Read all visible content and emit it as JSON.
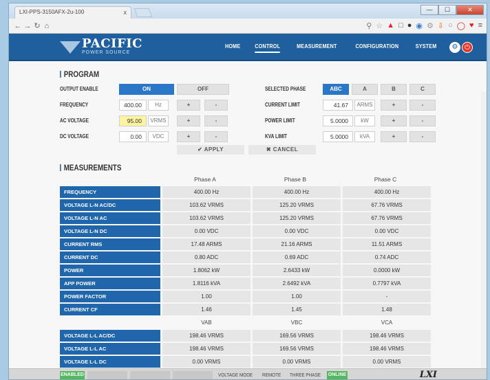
{
  "browser": {
    "tab_title": "LXI-PPS-3150AFX-2u-100",
    "tab_close": "x",
    "url": "",
    "window_buttons": [
      "—",
      "☐",
      "✕"
    ]
  },
  "header": {
    "logo_name": "PACIFIC",
    "logo_sub": "POWER SOURCE",
    "nav": [
      "HOME",
      "CONTROL",
      "MEASUREMENT",
      "CONFIGURATION",
      "SYSTEM"
    ],
    "active_nav": "CONTROL"
  },
  "program": {
    "title": "PROGRAM",
    "output_enable": {
      "label": "OUTPUT ENABLE",
      "on": "ON",
      "off": "OFF"
    },
    "frequency": {
      "label": "FREQUENCY",
      "value": "400.00",
      "unit": "Hz"
    },
    "ac_voltage": {
      "label": "AC VOLTAGE",
      "value": "95.00",
      "unit": "VRMS"
    },
    "dc_voltage": {
      "label": "DC VOLTAGE",
      "value": "0.00",
      "unit": "VDC"
    },
    "selected_phase": {
      "label": "SELECTED PHASE",
      "options": [
        "ABC",
        "A",
        "B",
        "C"
      ]
    },
    "current_limit": {
      "label": "CURRENT LIMIT",
      "value": "41.67",
      "unit": "ARMS"
    },
    "power_limit": {
      "label": "POWER LIMIT",
      "value": "5.0000",
      "unit": "kW"
    },
    "kva_limit": {
      "label": "KVA LIMIT",
      "value": "5.0000",
      "unit": "kVA"
    },
    "plus": "+",
    "minus": "-",
    "apply": "✔ APPLY",
    "cancel": "✖ CANCEL"
  },
  "measurements": {
    "title": "MEASUREMENTS",
    "phase_headers": [
      "Phase A",
      "Phase B",
      "Phase C"
    ],
    "rows": [
      {
        "label": "FREQUENCY",
        "values": [
          "400.00 Hz",
          "400.00 Hz",
          "400.00 Hz"
        ]
      },
      {
        "label": "VOLTAGE L-N AC/DC",
        "values": [
          "103.62 VRMS",
          "125.20 VRMS",
          "67.76 VRMS"
        ]
      },
      {
        "label": "VOLTAGE L-N AC",
        "values": [
          "103.62 VRMS",
          "125.20 VRMS",
          "67.76 VRMS"
        ]
      },
      {
        "label": "VOLTAGE L-N DC",
        "values": [
          "0.00 VDC",
          "0.00 VDC",
          "0.00 VDC"
        ]
      },
      {
        "label": "CURRENT RMS",
        "values": [
          "17.48 ARMS",
          "21.16 ARMS",
          "11.51 ARMS"
        ]
      },
      {
        "label": "CURRENT DC",
        "values": [
          "0.80 ADC",
          "0.69 ADC",
          "0.74 ADC"
        ]
      },
      {
        "label": "POWER",
        "values": [
          "1.8062 kW",
          "2.6433 kW",
          "0.0000 kW"
        ]
      },
      {
        "label": "APP POWER",
        "values": [
          "1.8116 kVA",
          "2.6492 kVA",
          "0.7797 kVA"
        ]
      },
      {
        "label": "POWER FACTOR",
        "values": [
          "1.00",
          "1.00",
          "-"
        ]
      },
      {
        "label": "CURRENT CF",
        "values": [
          "1.46",
          "1.45",
          "1.48"
        ]
      }
    ],
    "ll_headers": [
      "VAB",
      "VBC",
      "VCA"
    ],
    "ll_rows": [
      {
        "label": "VOLTAGE L-L AC/DC",
        "values": [
          "198.46 VRMS",
          "169.56 VRMS",
          "198.46 VRMS"
        ]
      },
      {
        "label": "VOLTAGE L-L AC",
        "values": [
          "198.46 VRMS",
          "169.56 VRMS",
          "198.46 VRMS"
        ]
      },
      {
        "label": "VOLTAGE L-L DC",
        "values": [
          "0.00 VRMS",
          "0.00 VRMS",
          "0.00 VRMS"
        ]
      }
    ]
  },
  "status": {
    "enabled": "ENABLED",
    "mode": "VOLTAGE MODE",
    "remote": "REMOTE",
    "phase": "THREE PHASE",
    "online": "ONLINE",
    "logo": "LXI"
  },
  "colors": {
    "brand_blue": "#1f5f9e",
    "button_blue": "#2a77c7",
    "row_header": "#2066ad",
    "highlight_field": "#fdf3a0",
    "status_green": "#53b85e",
    "power_red": "#e5392a"
  }
}
